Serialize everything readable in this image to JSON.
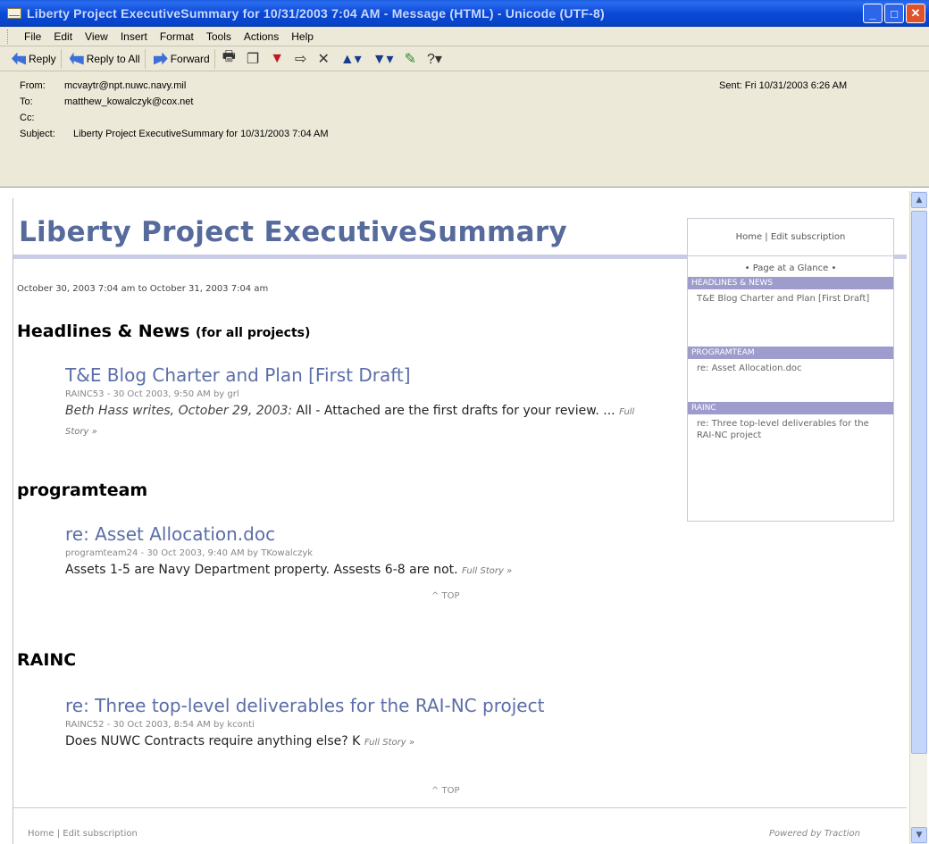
{
  "window": {
    "title": "Liberty Project ExecutiveSummary for 10/31/2003 7:04 AM - Message (HTML) - Unicode (UTF-8)"
  },
  "menu": [
    "File",
    "Edit",
    "View",
    "Insert",
    "Format",
    "Tools",
    "Actions",
    "Help"
  ],
  "toolbar": {
    "reply": "Reply",
    "reply_all": "Reply to All",
    "forward": "Forward"
  },
  "header": {
    "from_label": "From:",
    "from": "mcvaytr@npt.nuwc.navy.mil",
    "to_label": "To:",
    "to": "matthew_kowalczyk@cox.net",
    "cc_label": "Cc:",
    "cc": "",
    "subject_label": "Subject:",
    "subject": "Liberty Project ExecutiveSummary for 10/31/2003 7:04 AM",
    "sent_label": "Sent:",
    "sent": "Fri 10/31/2003 6:26 AM"
  },
  "page": {
    "title": "Liberty Project ExecutiveSummary",
    "daterange": "October 30, 2003 7:04 am to October 31, 2003 7:04 am",
    "sections": [
      {
        "heading": "Headlines & News",
        "heading_suffix": "(for all projects)",
        "item_title": "T&E Blog Charter and Plan [First Draft]",
        "item_meta": "RAINC53 - 30 Oct 2003, 9:50 AM by grl",
        "item_body_em": "Beth Hass writes, October 29, 2003:",
        "item_body": " All - Attached are the first drafts for your review. ... ",
        "full_story": "Full Story »"
      },
      {
        "heading": "programteam",
        "item_title": "re: Asset Allocation.doc",
        "item_meta": "programteam24 - 30 Oct 2003, 9:40 AM by TKowalczyk",
        "item_body": "Assets 1-5 are Navy Department property. Assests 6-8 are not. ",
        "full_story": "Full Story »"
      },
      {
        "heading": "RAINC",
        "item_title": "re: Three top-level deliverables for the RAI-NC project",
        "item_meta": "RAINC52 - 30 Oct 2003, 8:54 AM by kconti",
        "item_body": "Does NUWC Contracts require anything else? K ",
        "full_story": "Full Story »"
      }
    ],
    "top_link": "^ TOP",
    "footer_left": "Home | Edit subscription",
    "footer_right": "Powered by Traction"
  },
  "sidebar": {
    "top": "Home | Edit subscription",
    "glance": "• Page at a Glance •",
    "cats": [
      {
        "label": "HEADLINES & NEWS",
        "item": "T&E Blog Charter and Plan [First Draft]"
      },
      {
        "label": "PROGRAMTEAM",
        "item": "re: Asset Allocation.doc"
      },
      {
        "label": "RAINC",
        "item": "re: Three top-level deliverables for the RAI-NC project"
      }
    ]
  }
}
